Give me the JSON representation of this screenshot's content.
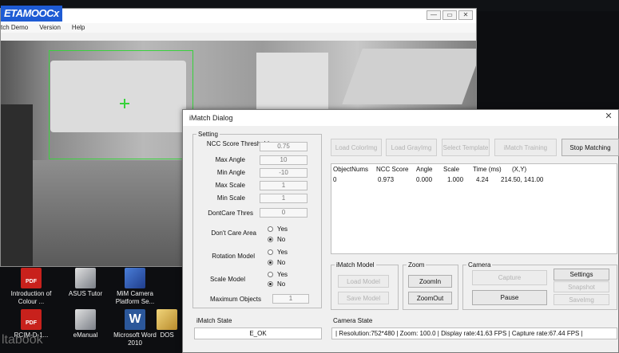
{
  "desktop": {
    "icons": [
      {
        "label": "Introduction of Colour ...",
        "icon": "pdf-icon"
      },
      {
        "label": "ASUS Tutor",
        "icon": "tool-icon"
      },
      {
        "label": "MiM Camera Platform Se...",
        "icon": "camera-icon"
      },
      {
        "label": "RCIM-D-1...",
        "icon": "pdf-icon"
      },
      {
        "label": "eManual",
        "icon": "tool-icon"
      },
      {
        "label": "Microsoft Word 2010",
        "icon": "word-icon"
      },
      {
        "label": "DOS",
        "icon": "doc-icon"
      }
    ],
    "watermark": "ltabook"
  },
  "main_window": {
    "logo": "ETAMOOCx",
    "menu": [
      "tch Demo",
      "Version",
      "Help"
    ],
    "window_buttons": [
      "—",
      "▭",
      "✕"
    ]
  },
  "dialog": {
    "title": "iMatch Dialog",
    "close_glyph": "✕",
    "setting": {
      "legend": "Setting",
      "fields": [
        {
          "label": "NCC Score Threshold",
          "value": "0.75"
        },
        {
          "label": "Max Angle",
          "value": "10"
        },
        {
          "label": "Min Angle",
          "value": "-10"
        },
        {
          "label": "Max Scale",
          "value": "1"
        },
        {
          "label": "Min Scale",
          "value": "1"
        },
        {
          "label": "DontCare Thres",
          "value": "0"
        }
      ],
      "radios": [
        {
          "label": "Don't Care Area",
          "options": [
            "Yes",
            "No"
          ],
          "selected": "No"
        },
        {
          "label": "Rotation Model",
          "options": [
            "Yes",
            "No"
          ],
          "selected": "No"
        },
        {
          "label": "Scale Model",
          "options": [
            "Yes",
            "No"
          ],
          "selected": "No"
        }
      ],
      "max_objects": {
        "label": "Maximum Objects",
        "value": "1"
      }
    },
    "toolbar": {
      "load_color": "Load ColorImg",
      "load_gray": "Load GrayImg",
      "select_template": "Select Template",
      "imatch_training": "iMatch Training",
      "stop_matching": "Stop Matching"
    },
    "results": {
      "columns": [
        "ObjectNums",
        "NCC Score",
        "Angle",
        "Scale",
        "Time (ms)",
        "(X,Y)"
      ],
      "rows": [
        [
          "0",
          "0.973",
          "0.000",
          "1.000",
          "4.24",
          "214.50, 141.00"
        ]
      ]
    },
    "imatch_model": {
      "legend": "iMatch Model",
      "load": "Load Model",
      "save": "Save Model"
    },
    "zoom": {
      "legend": "Zoom",
      "zoom_in": "ZoomIn",
      "zoom_out": "ZoomOut"
    },
    "camera": {
      "legend": "Camera",
      "capture": "Capture",
      "pause": "Pause",
      "settings": "Settings",
      "snapshot": "Snapshot",
      "saveimg": "SaveImg"
    },
    "imatch_state": {
      "label": "iMatch State",
      "value": "E_OK"
    },
    "camera_state": {
      "label": "Camera State",
      "value": "| Resolution:752*480 | Zoom: 100.0 | Display rate:41.63 FPS | Capture rate:67.44 FPS |"
    }
  },
  "colors": {
    "roi": "#38d23c",
    "logo_bg": "#1e5bd4"
  }
}
